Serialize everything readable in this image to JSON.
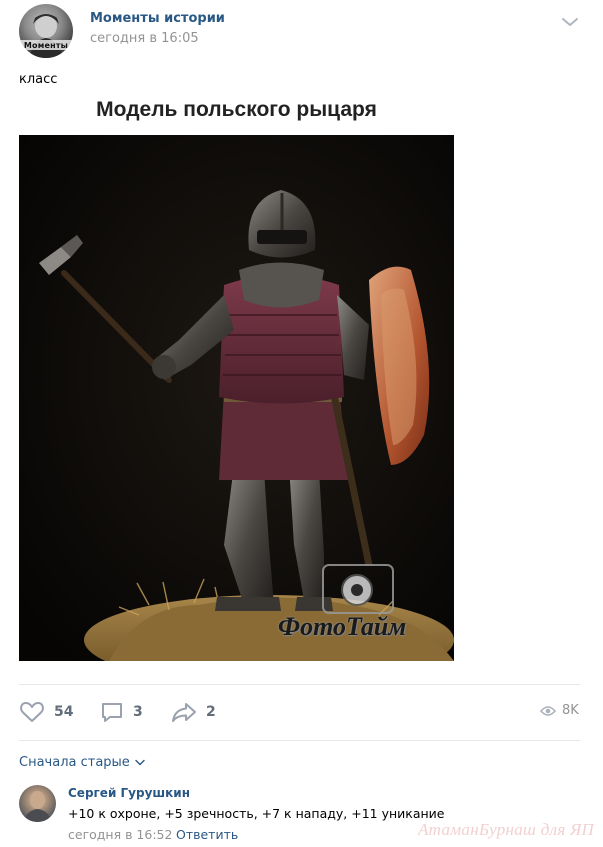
{
  "post": {
    "author": "Моменты истории",
    "avatar_text": "Моменты",
    "time": "сегодня в 16:05",
    "text": "класс",
    "image_title": "Модель польского рыцаря",
    "image_watermark": "ФотоТайм"
  },
  "actions": {
    "likes": "54",
    "comments": "3",
    "shares": "2",
    "views": "8K"
  },
  "comments": {
    "sort_label": "Сначала старые",
    "items": [
      {
        "author": "Сергей Гурушкин",
        "text": "+10 к охроне, +5 зречность, +7 к нападу, +11 уникание",
        "time": "сегодня в 16:52",
        "reply_label": "Ответить"
      }
    ]
  },
  "site_watermark": "АтаманБурнаш для ЯП",
  "colors": {
    "link": "#2a5885",
    "meta": "#939393",
    "action_icon": "#99a2ad",
    "divider": "#e7e8ec"
  }
}
